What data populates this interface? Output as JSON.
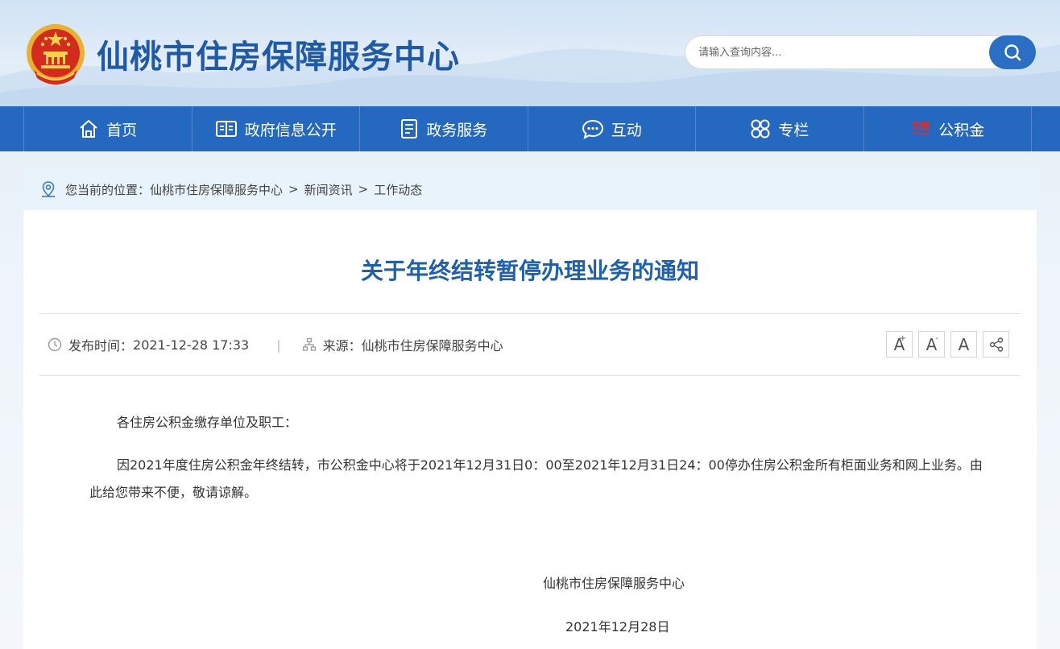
{
  "header": {
    "site_title": "仙桃市住房保障服务中心",
    "search_placeholder": "请输入查询内容..."
  },
  "nav": {
    "items": [
      {
        "label": "首页",
        "icon": "home-icon"
      },
      {
        "label": "政府信息公开",
        "icon": "book-icon"
      },
      {
        "label": "政务服务",
        "icon": "document-icon"
      },
      {
        "label": "互动",
        "icon": "chat-icon"
      },
      {
        "label": "专栏",
        "icon": "grid-icon"
      },
      {
        "label": "公积金",
        "icon": "fund-logo-icon"
      }
    ]
  },
  "breadcrumb": {
    "prefix": "您当前的位置：",
    "items": [
      "仙桃市住房保障服务中心",
      "新闻资讯",
      "工作动态"
    ],
    "separator": ">"
  },
  "article": {
    "title": "关于年终结转暂停办理业务的通知",
    "publish_label": "发布时间：",
    "publish_time": "2021-12-28 17:33",
    "divider": "|",
    "source_label": "来源：",
    "source": "仙桃市住房保障服务中心",
    "tools": {
      "font_larger": "A",
      "font_smaller": "A",
      "font_default": "A",
      "plus": "+",
      "minus": "-"
    },
    "greeting": "各住房公积金缴存单位及职工：",
    "paragraph": "因2021年度住房公积金年终结转，市公积金中心将于2021年12月31日0：00至2021年12月31日24：00停办住房公积金所有柜面业务和网上业务。由此给您带来不便，敬请谅解。",
    "signature_org": "仙桃市住房保障服务中心",
    "signature_date": "2021年12月28日"
  },
  "colors": {
    "brand_blue": "#2568bf",
    "title_blue": "#1e5fae",
    "header_title_blue": "#1e5aa8",
    "crumb_bg": "#e9f3fc"
  }
}
